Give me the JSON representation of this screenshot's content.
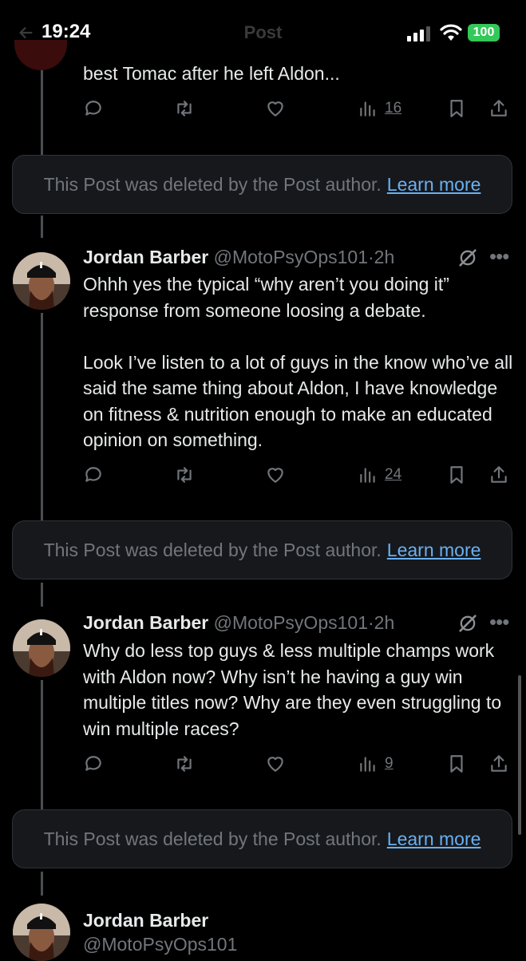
{
  "status_bar": {
    "time": "19:24",
    "battery": "100"
  },
  "header": {
    "title": "Post"
  },
  "posts": [
    {
      "text_tail": "best Tomac after he left Aldon...",
      "views": "16"
    },
    {
      "author": "Jordan Barber",
      "handle": "@MotoPsyOps101",
      "time": "2h",
      "text": "Ohhh yes the typical “why aren’t you doing it” response from someone loosing a debate.\n\nLook I’ve listen to a lot of guys in the know who’ve all said the same thing about Aldon, I have knowledge on fitness & nutrition enough to make an educated opinion on something.",
      "views": "24"
    },
    {
      "author": "Jordan Barber",
      "handle": "@MotoPsyOps101",
      "time": "2h",
      "text": "Why do less top guys & less multiple champs work with Aldon now? Why isn’t he having a guy win multiple titles now? Why are they even struggling to win multiple races?",
      "views": "9"
    },
    {
      "author": "Jordan Barber",
      "handle": "@MotoPsyOps101"
    }
  ],
  "deleted_notice": {
    "text": "This Post was deleted by the Post author.",
    "link": "Learn more"
  },
  "separator": "·",
  "colors": {
    "background": "#000000",
    "text": "#e7e9ea",
    "muted": "#71767b",
    "link": "#6ab0ef",
    "battery": "#34c759"
  }
}
